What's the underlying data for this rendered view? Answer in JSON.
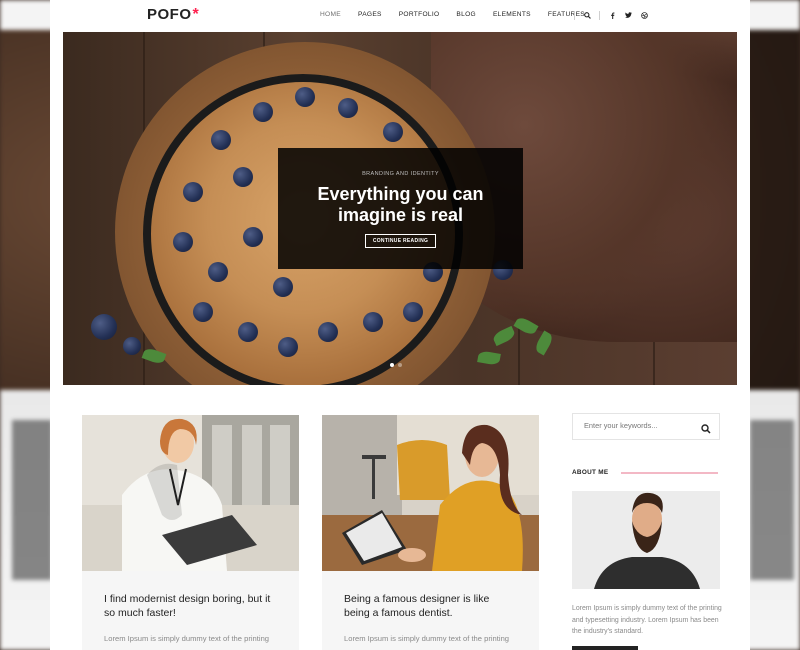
{
  "brand": {
    "name": "POFO",
    "mark": "*",
    "accent": "#ff214f"
  },
  "nav": {
    "items": [
      {
        "label": "HOME"
      },
      {
        "label": "PAGES"
      },
      {
        "label": "PORTFOLIO"
      },
      {
        "label": "BLOG"
      },
      {
        "label": "ELEMENTS"
      },
      {
        "label": "FEATURES"
      }
    ],
    "icons": [
      "search-icon",
      "facebook-icon",
      "twitter-icon",
      "dribbble-icon"
    ]
  },
  "hero": {
    "category": "BRANDING AND IDENTITY",
    "title_line1": "Everything you can",
    "title_line2": "imagine is real",
    "button_label": "CONTINUE READING",
    "slide_count": 2,
    "active_slide": 1
  },
  "posts": [
    {
      "title": "I find modernist design boring, but it so much faster!",
      "excerpt": "Lorem Ipsum is simply dummy text of the printing and typesetting industry. Lorem Ipsum"
    },
    {
      "title": "Being a famous designer is like being a famous dentist.",
      "excerpt": "Lorem Ipsum is simply dummy text of the printing and typesetting industry. Lorem Ipsum"
    }
  ],
  "sidebar": {
    "search_placeholder": "Enter your keywords...",
    "about_heading": "ABOUT ME",
    "about_text": "Lorem Ipsum is simply dummy text of the printing and typesetting industry. Lorem Ipsum has been the industry's standard."
  }
}
